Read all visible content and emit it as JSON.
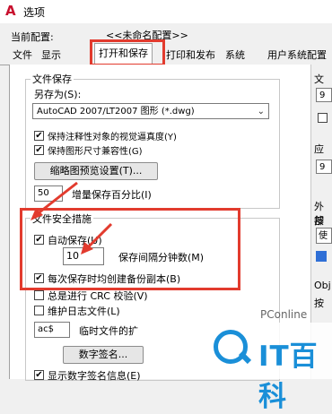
{
  "window": {
    "title": "选项"
  },
  "profile": {
    "label": "当前配置:",
    "value": "<<未命名配置>>"
  },
  "tabs": [
    "文件",
    "显示",
    "打开和保存",
    "打印和发布",
    "系统",
    "用户系统配置"
  ],
  "file_save": {
    "title": "文件保存",
    "save_as_label": "另存为(S):",
    "save_as_value": "AutoCAD 2007/LT2007 图形 (*.dwg)",
    "keep_annotative": "保持注释性对象的视觉逼真度(Y)",
    "keep_drawing_size": "保持图形尺寸兼容性(G)",
    "thumbnail_button": "缩略图预览设置(T)...",
    "incremental_value": "50",
    "incremental_label": "增量保存百分比(I)"
  },
  "safety": {
    "title": "文件安全措施",
    "autosave_label": "自动保存(U)",
    "interval_value": "10",
    "interval_label": "保存间隔分钟数(M)",
    "backup_label": "每次保存时均创建备份副本(B)",
    "crc_label": "总是进行 CRC 校验(V)",
    "log_label": "维护日志文件(L)",
    "temp_ext_value": "ac$",
    "temp_ext_label": "临时文件的扩",
    "digital_sign_button": "数字签名...",
    "show_sign_label": "显示数字签名信息(E)"
  },
  "right_panel": {
    "item1": "文",
    "item2": "9",
    "item3": "应",
    "item4": "9",
    "item5": "外部",
    "item6": "按",
    "item7": "使",
    "item8": "按",
    "item9": "Obj",
    "item10": "按"
  },
  "watermark": {
    "brand": "PConline",
    "text": "IT百科"
  },
  "colors": {
    "highlight": "#e23b2e",
    "accent": "#c8102e",
    "watermark_blue": "#1a8fd8"
  }
}
